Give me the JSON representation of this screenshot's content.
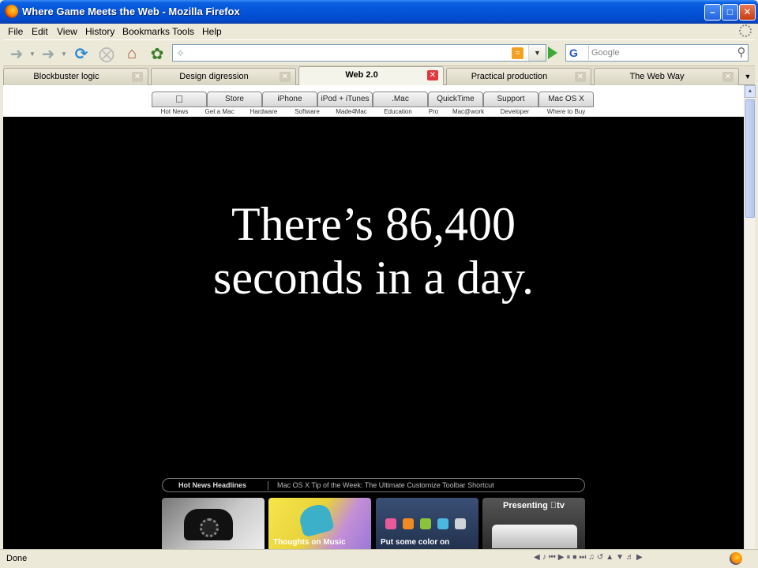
{
  "window": {
    "title": "Where Game Meets the Web - Mozilla Firefox",
    "minimize_glyph": "–",
    "maximize_glyph": "□",
    "close_glyph": "✕"
  },
  "menu": [
    "File",
    "Edit",
    "View",
    "History",
    "Bookmarks",
    "Tools",
    "Help"
  ],
  "search": {
    "engine_glyph": "G",
    "placeholder": "Google"
  },
  "tabs": [
    {
      "label": "Blockbuster logic"
    },
    {
      "label": "Design digression"
    },
    {
      "label": "Web 2.0",
      "active": true
    },
    {
      "label": "Practical production"
    },
    {
      "label": "The Web Way"
    }
  ],
  "apple_nav": {
    "logo_glyph": "",
    "tabs": [
      "Store",
      "iPhone",
      "iPod + iTunes",
      ".Mac",
      "QuickTime",
      "Support",
      "Mac OS X"
    ],
    "subnav": [
      "Hot News",
      "Get a Mac",
      "Hardware",
      "Software",
      "Made4Mac",
      "Education",
      "Pro",
      "Mac@work",
      "Developer",
      "Where to Buy"
    ]
  },
  "slide": {
    "line1": "There’s 86,400",
    "line2": "seconds in a day."
  },
  "headlines": {
    "label": "Hot News Headlines",
    "text": "Mac OS X Tip of the Week: The Ultimate Customize Toolbar Shortcut"
  },
  "promos": [
    {
      "label": ""
    },
    {
      "label": "Thoughts on Music"
    },
    {
      "label": "Put some color on"
    },
    {
      "label": "Presenting tv"
    }
  ],
  "status": {
    "text": "Done"
  },
  "colors": {
    "titlebar": "#0554d8",
    "tab_close_active": "#e0383c",
    "content_bg": "#000000"
  }
}
